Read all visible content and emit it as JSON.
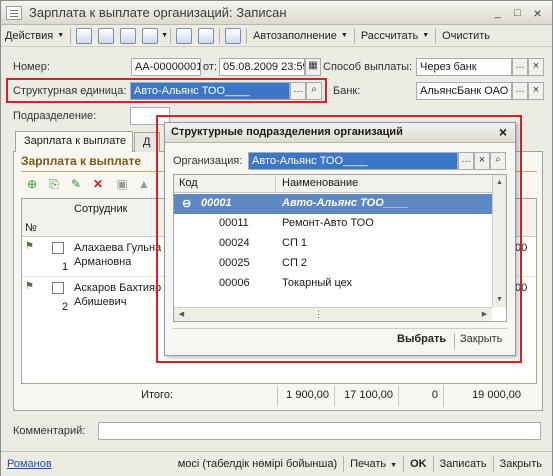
{
  "window": {
    "title": "Зарплата к выплате организаций: Записан",
    "minimize": "_",
    "maximize": "□",
    "close": "×"
  },
  "toolbar": {
    "actions_label": "Действия",
    "autofill_label": "Автозаполнение",
    "calculate_label": "Рассчитать",
    "clear_label": "Очистить"
  },
  "form": {
    "number_label": "Номер:",
    "number_value": "АА-00000001",
    "date_label": "от:",
    "date_value": "05.08.2009 23:59:59",
    "payment_method_label": "Способ выплаты:",
    "payment_method_value": "Через банк",
    "structural_unit_label": "Структурная единица:",
    "structural_unit_value": "Авто-Альянс ТОО____",
    "bank_label": "Банк:",
    "bank_value": "АльянсБанк ОАО",
    "subdivision_label": "Подразделение:",
    "subdivision_value": ""
  },
  "tabs": [
    {
      "label": "Зарплата к выплате"
    },
    {
      "label": "Д"
    }
  ],
  "section": {
    "title": "Зарплата к выплате"
  },
  "table": {
    "col_num": "№",
    "col_employee": "Сотрудник",
    "rows": [
      {
        "num": "1",
        "employee_line1": "Алахаева Гульна",
        "employee_line2": "Армановна",
        "tail": ",00"
      },
      {
        "num": "2",
        "employee_line1": "Аскаров Бахтияр",
        "employee_line2": "Абишевич",
        "tail": ",00"
      }
    ],
    "totals_label": "Итого:",
    "totals": [
      "1 900,00",
      "17 100,00",
      "0",
      "19 000,00"
    ]
  },
  "comment_label": "Комментарий:",
  "comment_value": "",
  "statusbar": {
    "user": "Романов",
    "mode_text": "мосі (табелдік нөмірі бойынша)",
    "print_label": "Печать",
    "ok_label": "OK",
    "save_label": "Записать",
    "close_label": "Закрыть"
  },
  "dialog": {
    "title": "Структурные подразделения организаций",
    "close_icon": "×",
    "org_label": "Организация:",
    "org_value": "Авто-Альянс ТОО____",
    "col_code": "Код",
    "col_name": "Наименование",
    "rows": [
      {
        "code": "00001",
        "name": "Авто-Альянс ТОО____",
        "group": true
      },
      {
        "code": "00011",
        "name": "Ремонт-Авто ТОО",
        "group": false
      },
      {
        "code": "00024",
        "name": "СП 1",
        "group": false
      },
      {
        "code": "00025",
        "name": "СП 2",
        "group": false
      },
      {
        "code": "00006",
        "name": "Токарный цех",
        "group": false
      }
    ],
    "select_label": "Выбрать",
    "close_label": "Закрыть"
  }
}
